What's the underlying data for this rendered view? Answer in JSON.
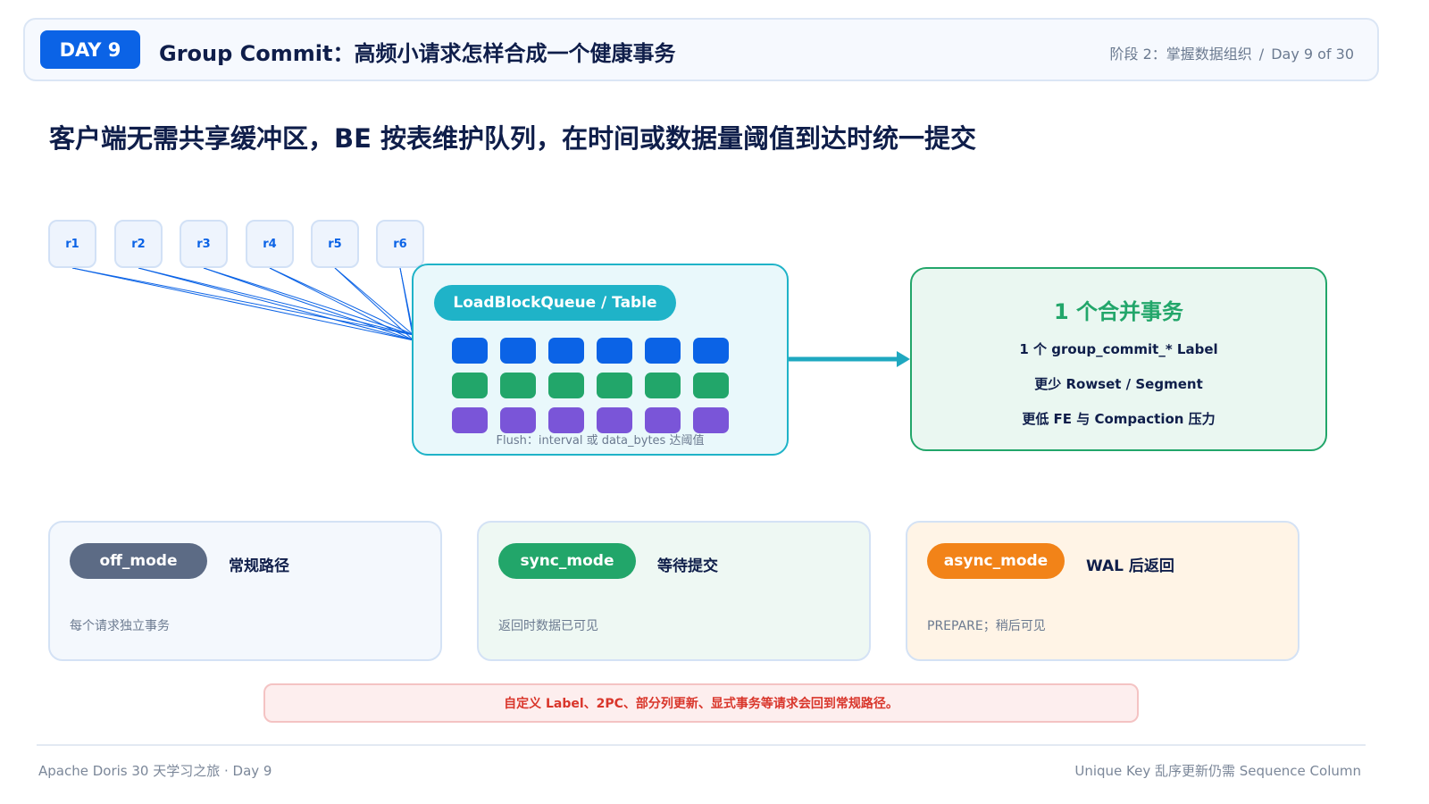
{
  "header": {
    "day_badge": "DAY 9",
    "title": "Group Commit：高频小请求怎样合成一个健康事务",
    "stage": "阶段 2：掌握数据组织",
    "separator": "/",
    "progress": "Day 9 of 30"
  },
  "subtitle": "客户端无需共享缓冲区，BE 按表维护队列，在时间或数据量阈值到达时统一提交",
  "requests": [
    "r1",
    "r2",
    "r3",
    "r4",
    "r5",
    "r6"
  ],
  "queue": {
    "label": "LoadBlockQueue / Table",
    "block_rows": 3,
    "block_cols": 6,
    "row_colors": [
      "#0b63e6",
      "#22a66a",
      "#7a55d8"
    ],
    "flush_text": "Flush：interval 或 data_bytes 达阈值"
  },
  "colors": {
    "accent": "#0b63e6",
    "queue": "#1fb3c8",
    "success": "#22a66a",
    "warning": "#f28318",
    "neutral": "#5c6b85",
    "danger": "#d9362b",
    "arrow": "#1fa8c0"
  },
  "transaction": {
    "title": "1 个合并事务",
    "lines": [
      "1 个 group_commit_* Label",
      "更少 Rowset / Segment",
      "更低 FE 与 Compaction 压力"
    ]
  },
  "modes": [
    {
      "name": "off_mode",
      "label": "常规路径",
      "desc": "每个请求独立事务",
      "color": "#5c6b85",
      "bg": "#f4f8fd"
    },
    {
      "name": "sync_mode",
      "label": "等待提交",
      "desc": "返回时数据已可见",
      "color": "#22a66a",
      "bg": "#eef8f3"
    },
    {
      "name": "async_mode",
      "label": "WAL 后返回",
      "desc": "PREPARE；稍后可见",
      "color": "#f28318",
      "bg": "#fff4e6"
    }
  ],
  "note": "自定义 Label、2PC、部分列更新、显式事务等请求会回到常规路径。",
  "footer": {
    "left": "Apache Doris 30 天学习之旅 · Day 9",
    "right": "Unique Key 乱序更新仍需 Sequence Column"
  }
}
